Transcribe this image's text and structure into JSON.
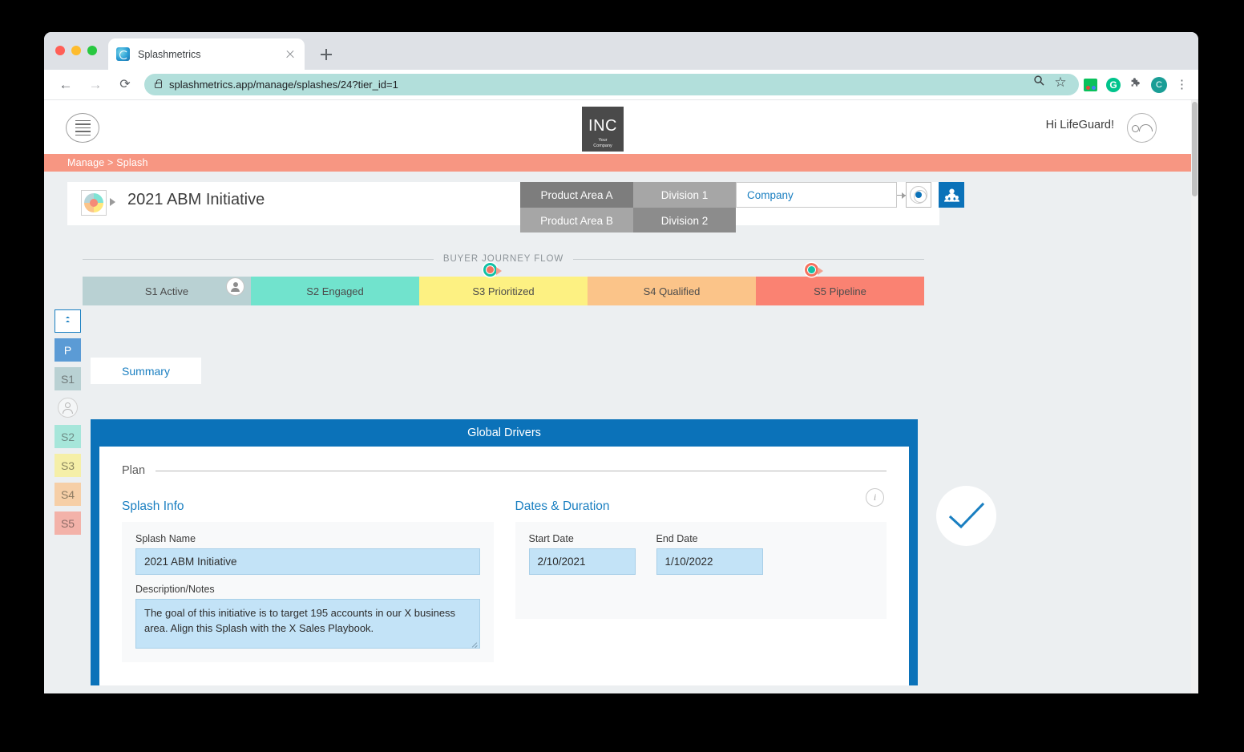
{
  "browser": {
    "tab_title": "Splashmetrics",
    "url": "splashmetrics.app/manage/splashes/24?tier_id=1",
    "back_glyph": "←",
    "forward_glyph": "→",
    "reload_glyph": "⟳",
    "new_tab_glyph": "+",
    "ext_g_letter": "G",
    "ext_puzzle_glyph": "🧩",
    "profile_letter": "C",
    "menu_glyph": "⋮"
  },
  "app_header": {
    "logo_main": "INC",
    "logo_sub_line1": "Your",
    "logo_sub_line2": "Company",
    "greeting": "Hi LifeGuard!"
  },
  "breadcrumb": "Manage > Splash",
  "title_bar": {
    "title": "2021 ABM Initiative"
  },
  "tiers": {
    "product_area_a": "Product Area A",
    "product_area_b": "Product Area B",
    "division_1": "Division 1",
    "division_2": "Division 2",
    "company": "Company"
  },
  "journey": {
    "label": "BUYER JOURNEY FLOW",
    "stages": [
      {
        "label": "S1 Active",
        "color": "#b9d1d3"
      },
      {
        "label": "S2 Engaged",
        "color": "#71e3cd"
      },
      {
        "label": "S3 Prioritized",
        "color": "#fdf182"
      },
      {
        "label": "S4 Qualified",
        "color": "#fbc489"
      },
      {
        "label": "S5 Pipeline",
        "color": "#fa8272"
      }
    ]
  },
  "stage_sidebar": {
    "items": [
      {
        "label": "P",
        "color": "#5b9bd5"
      },
      {
        "label": "S1",
        "color": "#b9d1d3"
      },
      {
        "label": "S2",
        "color": "#a6e6da"
      },
      {
        "label": "S3",
        "color": "#f5efa8"
      },
      {
        "label": "S4",
        "color": "#f6cfa7"
      },
      {
        "label": "S5",
        "color": "#f3b2a9"
      }
    ]
  },
  "tabs": {
    "summary": "Summary"
  },
  "global_drivers": {
    "header": "Global Drivers",
    "plan_label": "Plan",
    "splash_info": {
      "section_title": "Splash Info",
      "name_label": "Splash Name",
      "name_value": "2021 ABM Initiative",
      "description_label": "Description/Notes",
      "description_value": "The goal of this initiative is to target 195 accounts in our X business area. Align this Splash with the X Sales Playbook."
    },
    "dates": {
      "section_title": "Dates & Duration",
      "start_label": "Start Date",
      "start_value": "2/10/2021",
      "end_label": "End Date",
      "end_value": "1/10/2022"
    },
    "info_glyph": "i"
  },
  "colors": {
    "accent_blue": "#0b72b9",
    "link_blue": "#1a7fc1",
    "breadcrumb_salmon": "#f79682",
    "field_blue": "#c3e3f7"
  }
}
